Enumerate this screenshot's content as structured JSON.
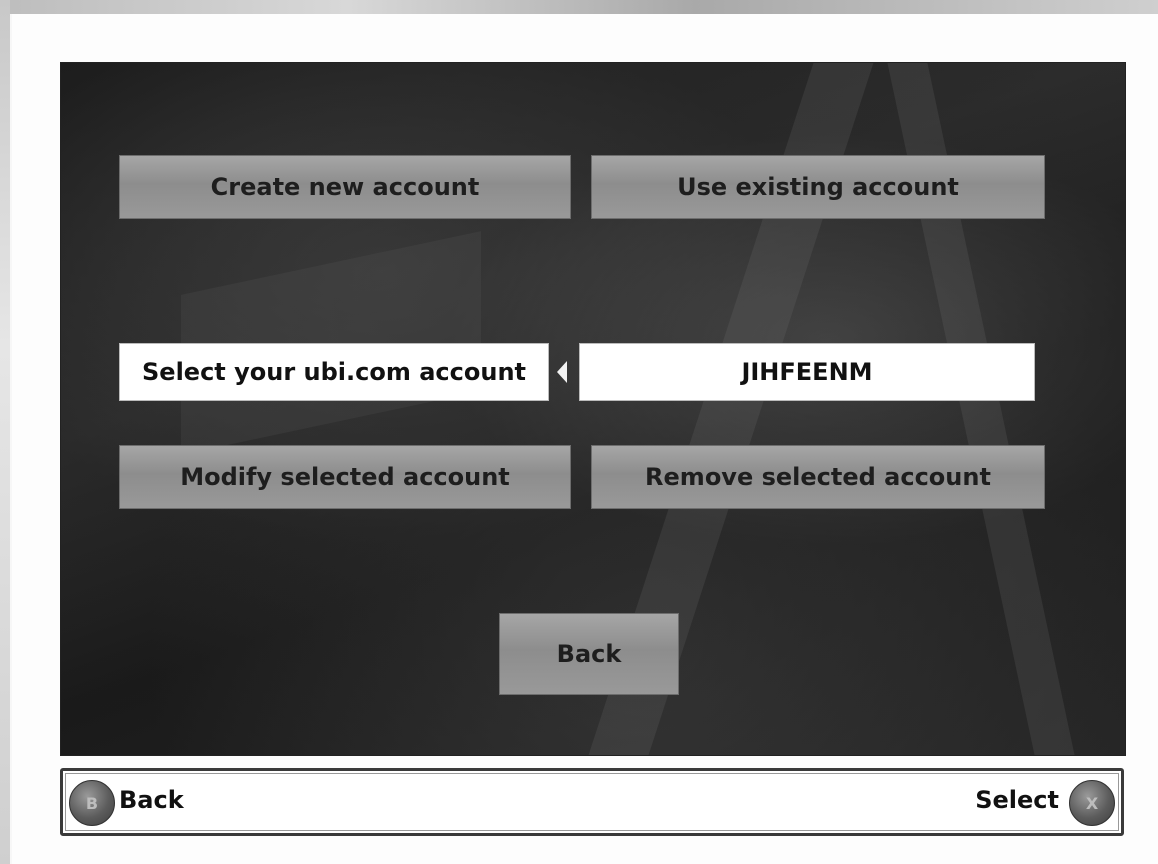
{
  "menu": {
    "create_new_account": "Create new account",
    "use_existing_account": "Use existing account",
    "select_account_label": "Select your ubi.com account",
    "selected_account": "JIHFEENM",
    "modify_selected_account": "Modify selected account",
    "remove_selected_account": "Remove selected account",
    "back_button": "Back"
  },
  "controls": {
    "back_label": "Back",
    "select_label": "Select",
    "back_glyph": "B",
    "select_glyph": "X"
  }
}
